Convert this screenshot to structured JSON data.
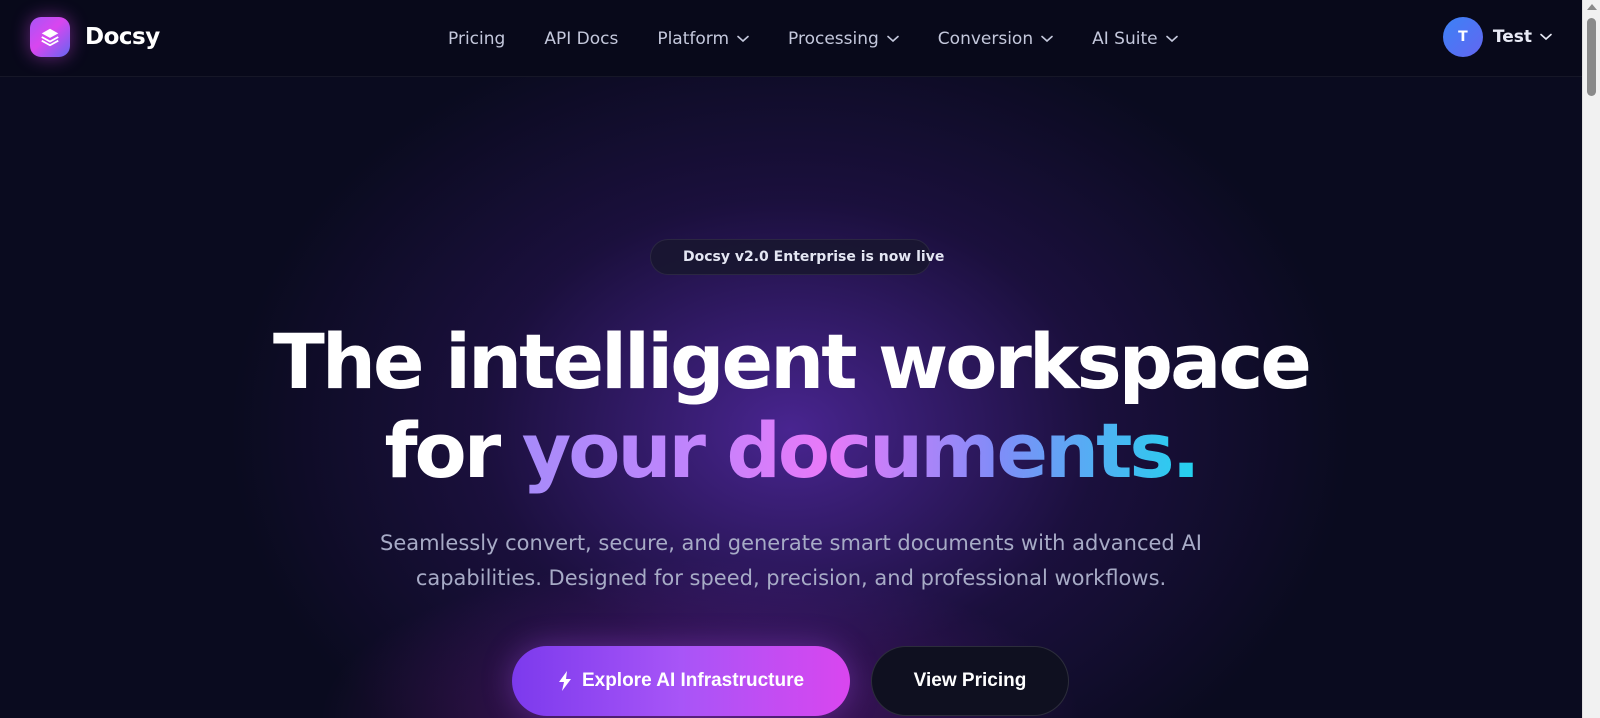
{
  "brand": {
    "name": "Docsy",
    "logo_icon": "layers-icon"
  },
  "nav": {
    "items": [
      {
        "label": "Pricing",
        "has_dropdown": false
      },
      {
        "label": "API Docs",
        "has_dropdown": false
      },
      {
        "label": "Platform",
        "has_dropdown": true
      },
      {
        "label": "Processing",
        "has_dropdown": true
      },
      {
        "label": "Conversion",
        "has_dropdown": true
      },
      {
        "label": "AI Suite",
        "has_dropdown": true
      }
    ]
  },
  "user": {
    "initial": "T",
    "name": "Test"
  },
  "hero": {
    "badge": "Docsy v2.0 Enterprise is now live",
    "headline_line1": "The intelligent workspace",
    "headline_line2_plain": "for",
    "headline_line2_gradient": "your documents.",
    "subtitle_line1": "Seamlessly convert, secure, and generate smart documents with advanced AI",
    "subtitle_line2": "capabilities. Designed for speed, precision, and professional workflows.",
    "primary_cta": "Explore AI Infrastructure",
    "secondary_cta": "View Pricing"
  },
  "colors": {
    "background": "#0a0b1f",
    "accent_purple": "#a855f7",
    "accent_magenta": "#d946ef",
    "accent_cyan": "#22d3ee",
    "badge_dot": "#e040fb"
  }
}
